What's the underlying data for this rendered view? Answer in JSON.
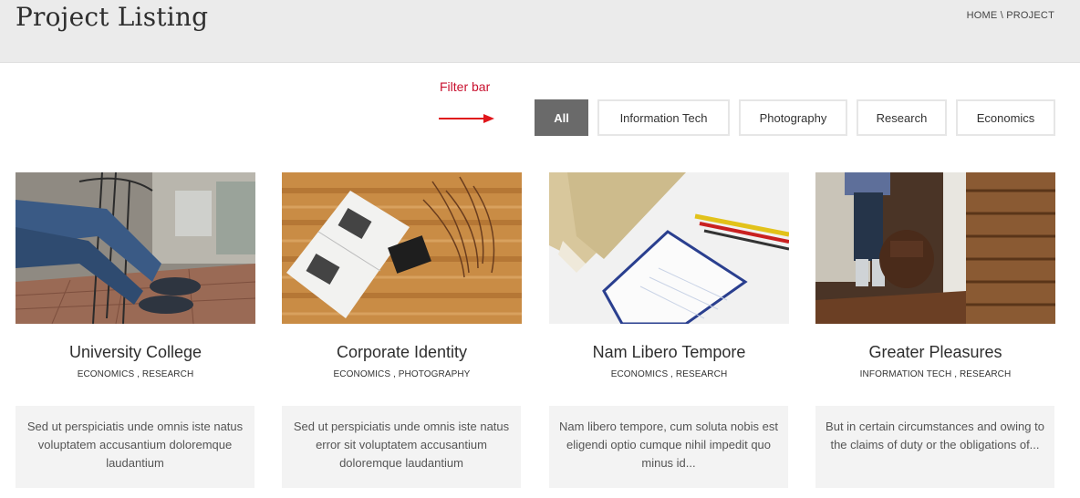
{
  "header": {
    "title": "Project Listing",
    "breadcrumb": {
      "home": "HOME",
      "separator": " \\ ",
      "current": "PROJECT"
    }
  },
  "annotation": {
    "label": "Filter bar",
    "color": "#c8102e"
  },
  "filters": [
    {
      "label": "All",
      "active": true
    },
    {
      "label": "Information Tech",
      "active": false
    },
    {
      "label": "Photography",
      "active": false
    },
    {
      "label": "Research",
      "active": false
    },
    {
      "label": "Economics",
      "active": false
    }
  ],
  "projects": [
    {
      "title": "University College",
      "tags": "ECONOMICS , RESEARCH",
      "description": "Sed ut perspiciatis unde omnis iste natus voluptatem accusantium doloremque laudantium",
      "image": "person-sitting-outdoor-cafe"
    },
    {
      "title": "Corporate Identity",
      "tags": "ECONOMICS , PHOTOGRAPHY",
      "description": "Sed ut perspiciatis unde omnis iste natus error sit voluptatem accusantium doloremque laudantium",
      "image": "open-book-on-wooden-table"
    },
    {
      "title": "Nam Libero Tempore",
      "tags": "ECONOMICS , RESEARCH",
      "description": "Nam libero tempore, cum soluta nobis est eligendi optio cumque nihil impedit quo minus id...",
      "image": "notebook-and-pencils"
    },
    {
      "title": "Greater Pleasures",
      "tags": "INFORMATION TECH , RESEARCH",
      "description": "But in certain circumstances and owing to the claims of duty or the obligations of...",
      "image": "person-with-backpack-stairs"
    }
  ],
  "colors": {
    "header_bg": "#ebebeb",
    "active_filter": "#6a6a6a",
    "desc_bg": "#f3f3f3"
  }
}
